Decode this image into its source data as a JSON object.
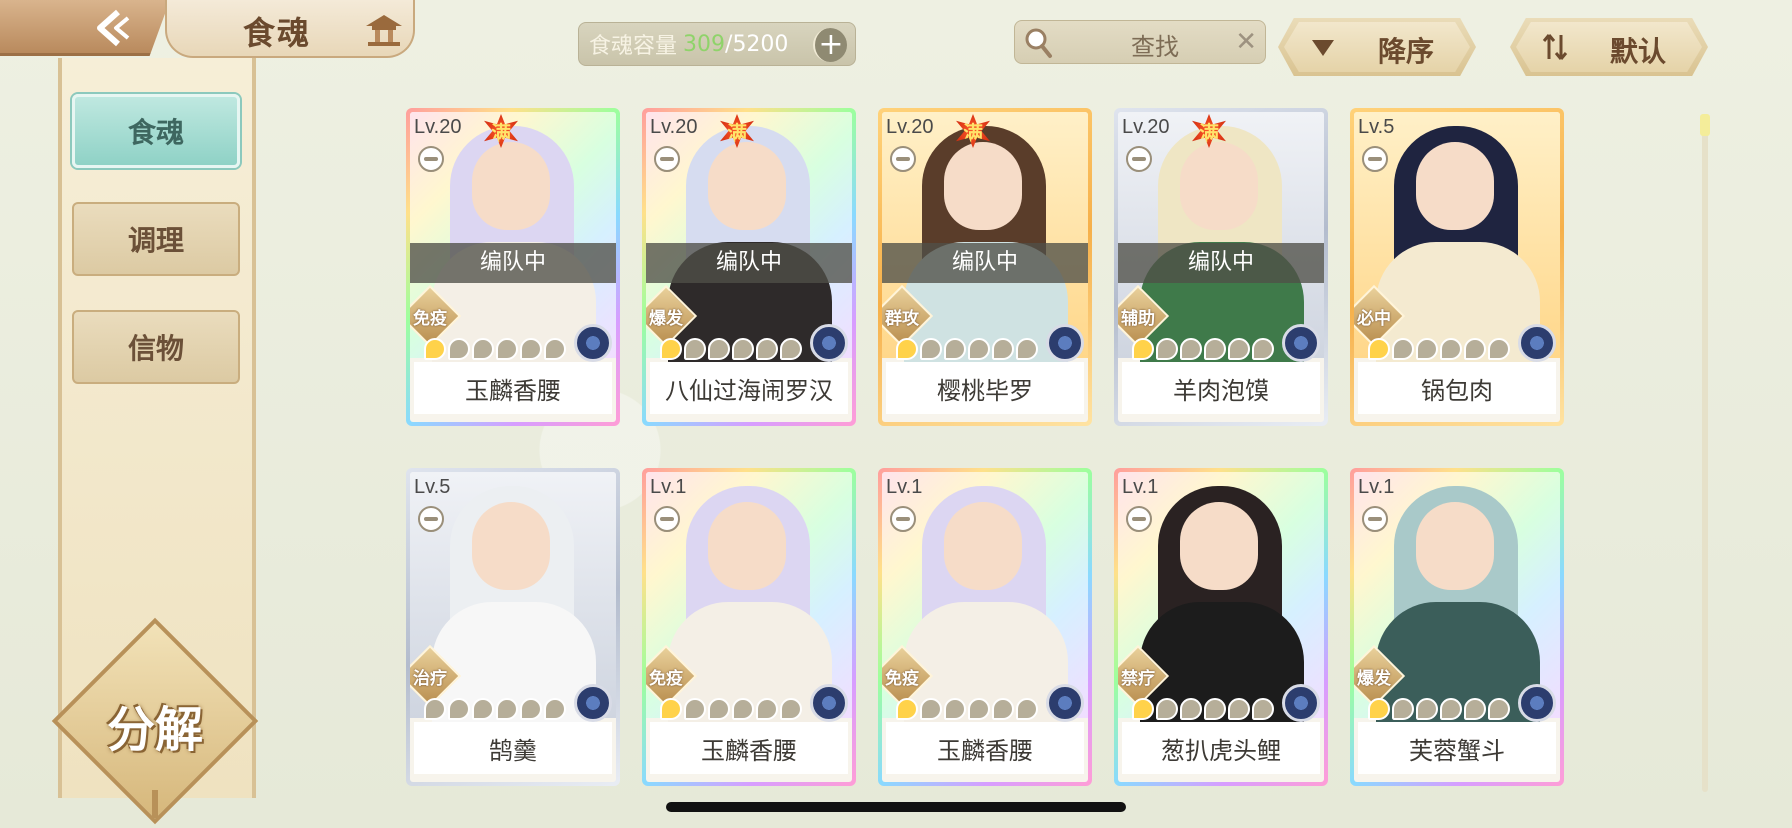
{
  "header": {
    "title": "食魂",
    "capacity_label": "食魂容量",
    "capacity_current": "309",
    "capacity_sep": "/",
    "capacity_max": "5200",
    "capacity_plus": "+",
    "search_label": "查找",
    "search_clear": "✕",
    "sort_order_label": "降序",
    "sort_mode_label": "默认"
  },
  "sidebar": {
    "items": [
      {
        "label": "食魂",
        "active": true
      },
      {
        "label": "调理",
        "active": false
      },
      {
        "label": "信物",
        "active": false
      }
    ],
    "decompose_label": "分解"
  },
  "cards": [
    {
      "level": "Lv.20",
      "full": "满",
      "in_team": "编队中",
      "role": "免疫",
      "stars": 1,
      "name": "玉麟香腰",
      "frame": "rainbow",
      "hair": "#dcd6f2",
      "outfit": "#f4efe6"
    },
    {
      "level": "Lv.20",
      "full": "满",
      "in_team": "编队中",
      "role": "爆发",
      "stars": 1,
      "name": "八仙过海闹罗汉",
      "frame": "rainbow",
      "hair": "#d6dcf0",
      "outfit": "#2e2a2a"
    },
    {
      "level": "Lv.20",
      "full": "满",
      "in_team": "编队中",
      "role": "群攻",
      "stars": 1,
      "name": "樱桃毕罗",
      "frame": "gold",
      "hair": "#5a3d2a",
      "outfit": "#cfe2e2"
    },
    {
      "level": "Lv.20",
      "full": "满",
      "in_team": "编队中",
      "role": "辅助",
      "stars": 1,
      "name": "羊肉泡馍",
      "frame": "silver",
      "hair": "#efe6c4",
      "outfit": "#3f7a4a"
    },
    {
      "level": "Lv.5",
      "full": "",
      "in_team": "",
      "role": "必中",
      "stars": 1,
      "name": "锅包肉",
      "frame": "gold",
      "hair": "#1f2440",
      "outfit": "#f4ead0"
    },
    {
      "level": "Lv.5",
      "full": "",
      "in_team": "",
      "role": "治疗",
      "stars": 0,
      "name": "鹄羹",
      "frame": "silver",
      "hair": "#eceff2",
      "outfit": "#f7f7f7"
    },
    {
      "level": "Lv.1",
      "full": "",
      "in_team": "",
      "role": "免疫",
      "stars": 1,
      "name": "玉麟香腰",
      "frame": "rainbow",
      "hair": "#dcd6f2",
      "outfit": "#f4efe6"
    },
    {
      "level": "Lv.1",
      "full": "",
      "in_team": "",
      "role": "免疫",
      "stars": 1,
      "name": "玉麟香腰",
      "frame": "rainbow",
      "hair": "#dcd6f2",
      "outfit": "#f4efe6"
    },
    {
      "level": "Lv.1",
      "full": "",
      "in_team": "",
      "role": "禁疗",
      "stars": 1,
      "name": "葱扒虎头鲤",
      "frame": "rainbow",
      "hair": "#2a2222",
      "outfit": "#1c1c1c"
    },
    {
      "level": "Lv.1",
      "full": "",
      "in_team": "",
      "role": "爆发",
      "stars": 1,
      "name": "芙蓉蟹斗",
      "frame": "rainbow",
      "hair": "#a9c9c9",
      "outfit": "#3b5e5a"
    }
  ],
  "colors": {
    "accent_text": "#6b4a2e",
    "capacity_current": "#8fd36a",
    "active_tab": "#8fd2c6"
  }
}
